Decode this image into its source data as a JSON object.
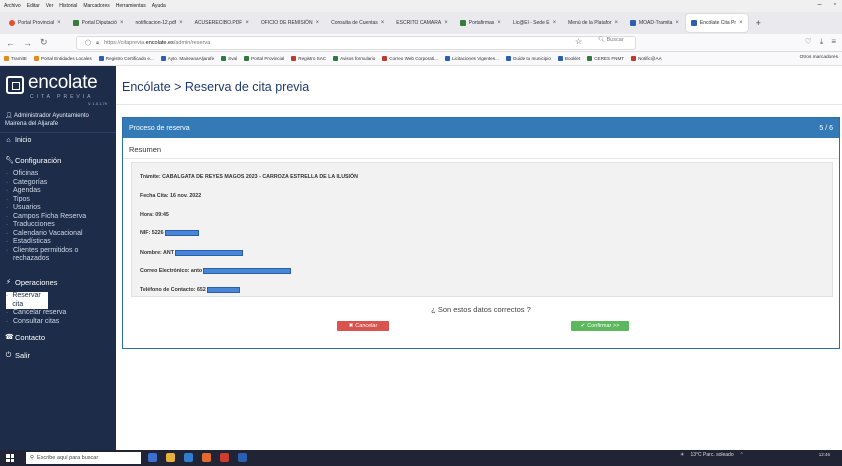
{
  "browser": {
    "menu": [
      "Archivo",
      "Editar",
      "Ver",
      "Historial",
      "Marcadores",
      "Herramientas",
      "Ayuda"
    ],
    "tabs": [
      {
        "label": "Portal Provincial",
        "active": false
      },
      {
        "label": "Portal Diputació",
        "active": false
      },
      {
        "label": "notificacion-12.pdf",
        "active": false
      },
      {
        "label": "ACUSERECIBO.PDF",
        "active": false
      },
      {
        "label": "OFICIO DE REMISIÓN",
        "active": false
      },
      {
        "label": "Consulta de Cuentas",
        "active": false
      },
      {
        "label": "ESCRITO CAMARA",
        "active": false
      },
      {
        "label": "Portafirmas",
        "active": false
      },
      {
        "label": "Lic@El - Sede E",
        "active": false
      },
      {
        "label": "Menú de la Platafor",
        "active": false
      },
      {
        "label": "MOAD-Tramita",
        "active": false
      },
      {
        "label": "Encólate Cita Pr",
        "active": true
      }
    ],
    "url_prefix": "https://citaprevia.",
    "url_domain": "encolate.es",
    "url_path": "/admin/reserva",
    "search_placeholder": "Buscar",
    "bookmarks": [
      "TramitE",
      "Portal Entidades Locales",
      "Registro Certificado e...",
      "Ayto. MaireanaAljarafe",
      "Sval",
      "Portal Provincial",
      "Registro SAC",
      "Avisos formulario",
      "Correo Web Corporati...",
      "Licitaciones Vigentes...",
      "Guide tu municipio",
      "Booklet",
      "CERES FNMT",
      "Notific@AA"
    ],
    "other_bookmarks": "Otros marcadores"
  },
  "sidebar": {
    "logo_text": "encolate",
    "logo_sub": "CITA PREVIA",
    "version": "V. 1.0.1.79",
    "user_name": "Administrador Ayuntamiento",
    "user_org": "Mairena del Aljarafe",
    "inicio": "Inicio",
    "config_title": "Configuración",
    "config_items": [
      "Oficinas",
      "Categorías",
      "Agendas",
      "Tipos",
      "Usuarios",
      "Campos Ficha Reserva",
      "Traducciones",
      "Calendario Vacacional",
      "Estadísticas",
      "Clientes permitidos o",
      "rechazados"
    ],
    "ops_title": "Operaciones",
    "ops_items": [
      "Reservar cita",
      "Cancelar reserva",
      "Consultar citas"
    ],
    "contacto": "Contacto",
    "salir": "Salir"
  },
  "main": {
    "title": "Encólate > Reserva de cita previa",
    "panel_title": "Proceso de reserva",
    "step": "5 / 6",
    "subtitle": "Resumen",
    "fields": {
      "tramite": "Trámite: CABALGATA DE REYES MAGOS 2023 - CARROZA ESTRELLA DE LA ILUSIÓN",
      "fecha": "Fecha Cita: 16 nov. 2022",
      "hora": "Hora: 09:45",
      "nif": "NIF: 5226",
      "nombre": "Nombre: ANT",
      "correo": "Correo Electrónico: anto",
      "telefono": "Teléfono de Contacto: 652"
    },
    "question": "¿ Son estos datos correctos ?",
    "cancel_label": "Cancelar",
    "confirm_label": "Confirmar >>"
  },
  "taskbar": {
    "search": "Escribe aquí para buscar",
    "weather": "13°C Parc. soleado",
    "time": "12:46"
  },
  "colors": {
    "sidebar_bg": "#1d2c49",
    "panel_head": "#347ab7",
    "cancel": "#d9534f",
    "confirm": "#5cb85c",
    "redaction": "#4a86d8"
  }
}
